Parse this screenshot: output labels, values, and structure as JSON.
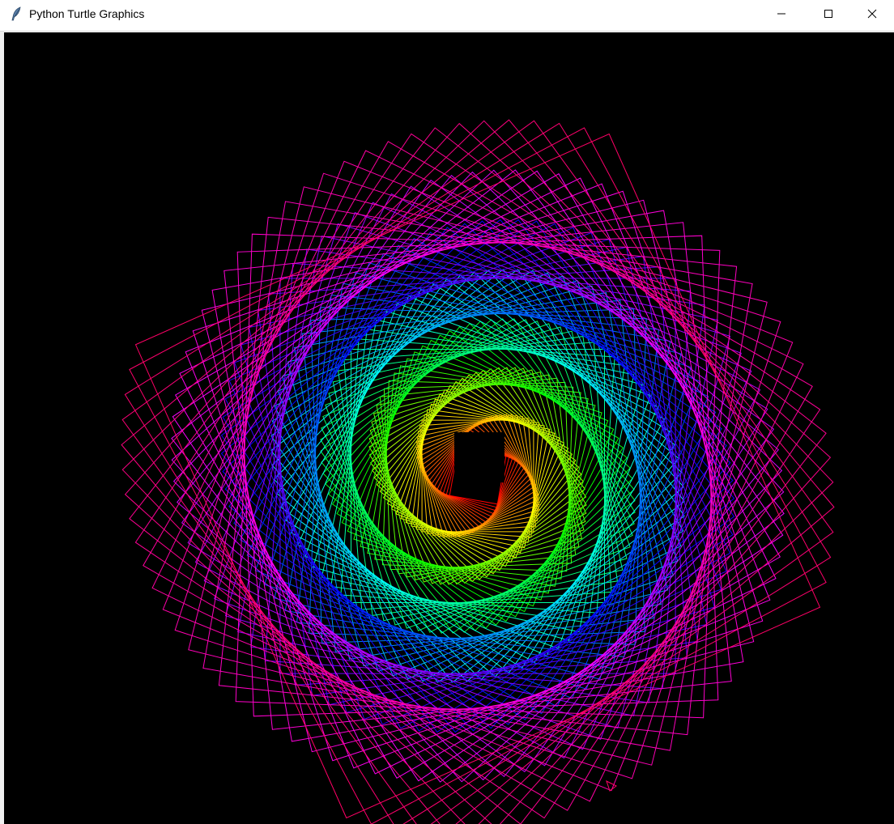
{
  "window": {
    "title": "Python Turtle Graphics"
  },
  "icons": {
    "app": "feather-icon",
    "minimize": "minimize-icon",
    "maximize": "maximize-icon",
    "close": "close-icon",
    "turtle": "turtle-arrow-cursor"
  },
  "canvas": {
    "background": "#000000"
  },
  "drawing": {
    "pattern": "rotating squares spiral",
    "color_sequence": [
      "#ff0000",
      "#ffff00",
      "#00ff00",
      "#00ffff",
      "#0000ff",
      "#ff00ff",
      "#ff0066"
    ]
  }
}
